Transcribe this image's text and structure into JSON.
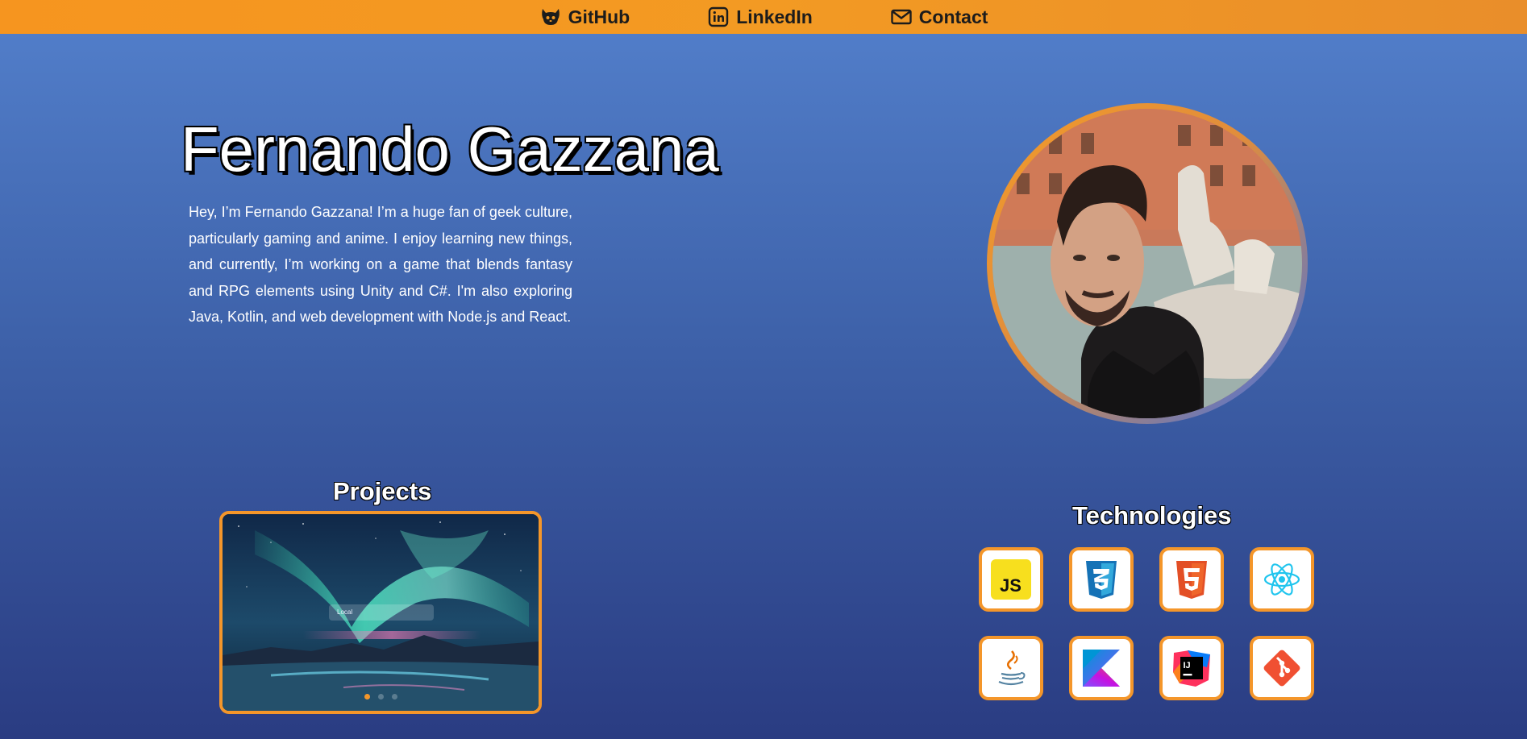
{
  "nav": {
    "items": [
      {
        "label": "GitHub",
        "icon": "github-icon"
      },
      {
        "label": "LinkedIn",
        "icon": "linkedin-icon"
      },
      {
        "label": "Contact",
        "icon": "mail-icon"
      }
    ]
  },
  "hero": {
    "name": "Fernando Gazzana",
    "bio": "Hey, I’m Fernando Gazzana! I’m a huge fan of geek culture, particularly gaming and anime. I enjoy learning new things, and currently, I’m working on a game that blends fantasy and RPG elements using Unity and C#. I'm also exploring Java, Kotlin, and web development with Node.js and React.",
    "avatar": "profile-photo"
  },
  "projects": {
    "title": "Projects",
    "card_search_text": "Local",
    "slides": 3,
    "active_slide": 1
  },
  "technologies": {
    "title": "Technologies",
    "items": [
      {
        "icon": "javascript-icon"
      },
      {
        "icon": "css3-icon"
      },
      {
        "icon": "html5-icon"
      },
      {
        "icon": "react-icon"
      },
      {
        "icon": "java-icon"
      },
      {
        "icon": "kotlin-icon"
      },
      {
        "icon": "intellij-icon"
      },
      {
        "icon": "git-icon"
      }
    ]
  },
  "colors": {
    "accent": "#f4962a",
    "nav_bg": "#f39a23",
    "page_top": "#5380cc",
    "page_bottom": "#2a3c82"
  }
}
